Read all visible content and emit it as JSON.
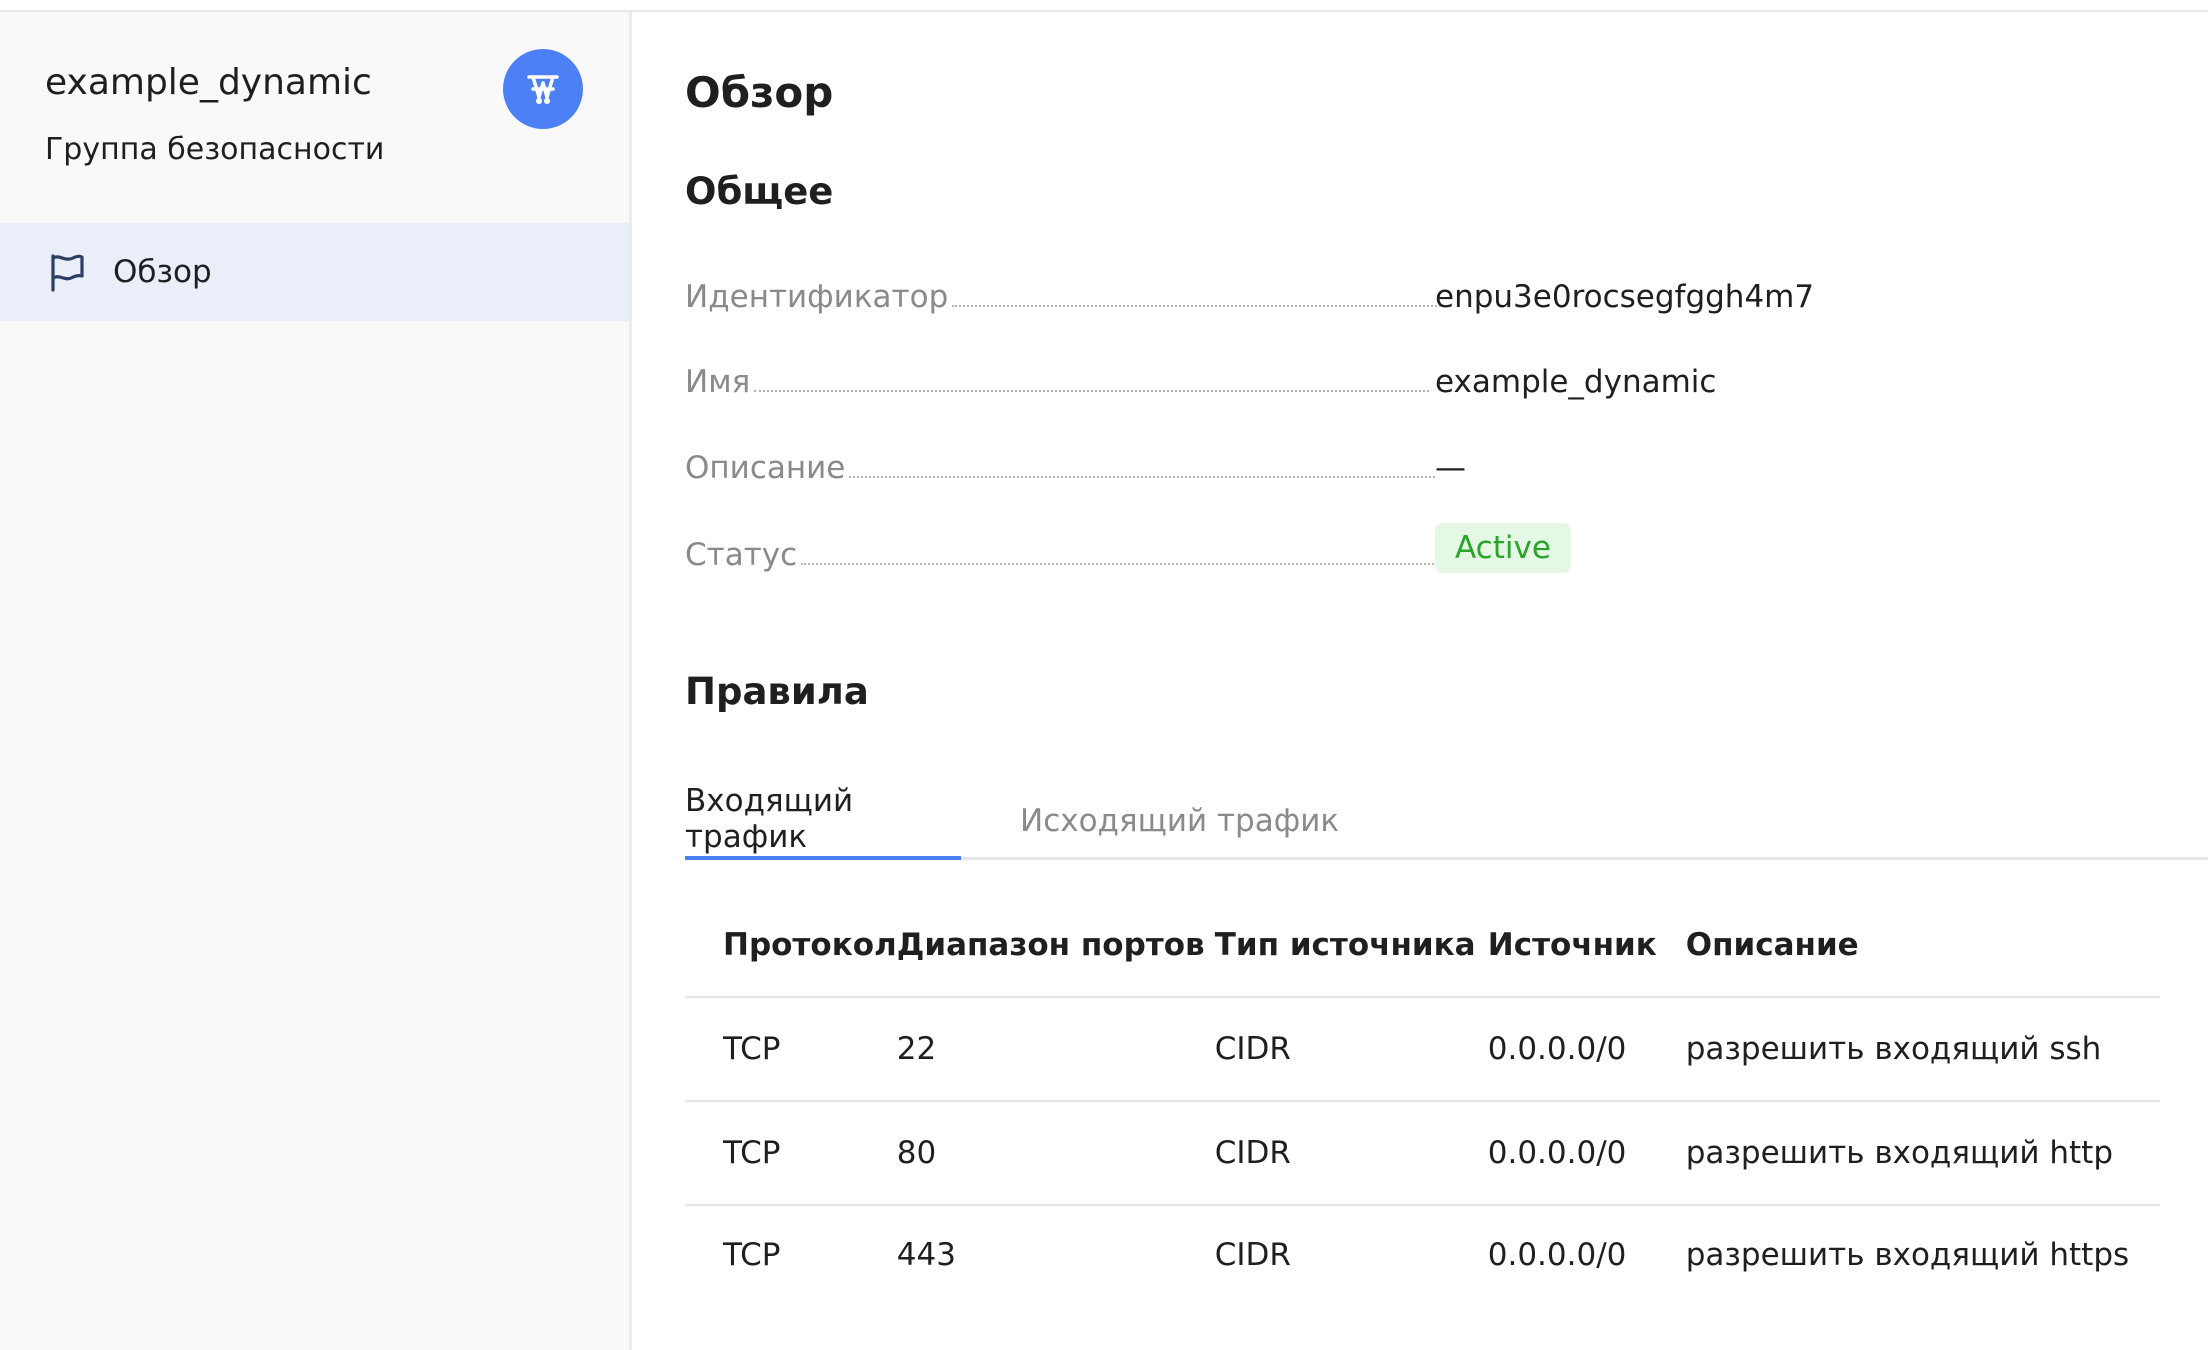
{
  "sidebar": {
    "title": "example_dynamic",
    "subtitle": "Группа безопасности",
    "avatar_icon": "network-icon",
    "nav_items": [
      {
        "label": "Обзор",
        "icon": "flag-icon",
        "active": true
      }
    ]
  },
  "main": {
    "page_title": "Обзор",
    "general": {
      "title": "Общее",
      "properties": [
        {
          "label": "Идентификатор",
          "value": "enpu3e0rocsegfggh4m7"
        },
        {
          "label": "Имя",
          "value": "example_dynamic"
        },
        {
          "label": "Описание",
          "value": "—"
        },
        {
          "label": "Статус",
          "value": "Active"
        }
      ]
    },
    "rules": {
      "title": "Правила",
      "tabs": [
        {
          "label": "Входящий трафик",
          "active": true
        },
        {
          "label": "Исходящий трафик",
          "active": false
        }
      ],
      "columns": [
        "Протокол",
        "Диапазон портов",
        "Тип источника",
        "Источник",
        "Описание"
      ],
      "rows": [
        [
          "TCP",
          "22",
          "CIDR",
          "0.0.0.0/0",
          "разрешить входящий ssh"
        ],
        [
          "TCP",
          "80",
          "CIDR",
          "0.0.0.0/0",
          "разрешить входящий http"
        ],
        [
          "TCP",
          "443",
          "CIDR",
          "0.0.0.0/0",
          "разрешить входящий https"
        ]
      ]
    }
  },
  "colors": {
    "accent": "#4d80f5",
    "status_active_bg": "#e5f7e5",
    "status_active_text": "#2aa52a",
    "sidebar_bg": "#f9f9f9",
    "nav_active_bg": "#eaeef9"
  }
}
